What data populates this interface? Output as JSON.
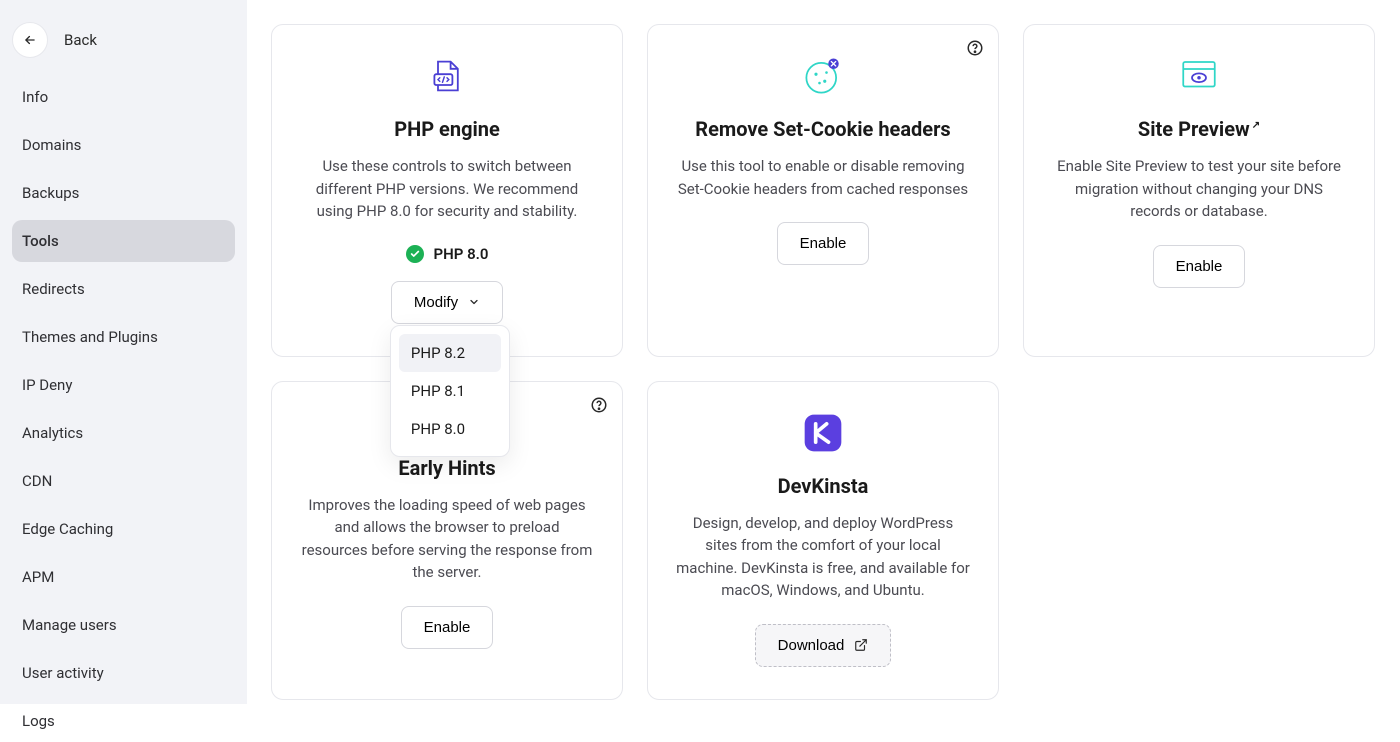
{
  "back_label": "Back",
  "sidebar": {
    "items": [
      {
        "label": "Info"
      },
      {
        "label": "Domains"
      },
      {
        "label": "Backups"
      },
      {
        "label": "Tools",
        "active": true
      },
      {
        "label": "Redirects"
      },
      {
        "label": "Themes and Plugins"
      },
      {
        "label": "IP Deny"
      },
      {
        "label": "Analytics"
      },
      {
        "label": "CDN"
      },
      {
        "label": "Edge Caching"
      },
      {
        "label": "APM"
      },
      {
        "label": "Manage users"
      },
      {
        "label": "User activity"
      },
      {
        "label": "Logs"
      }
    ]
  },
  "cards": {
    "php_engine": {
      "title": "PHP engine",
      "desc": "Use these controls to switch between different PHP versions. We recommend using PHP 8.0 for security and stability.",
      "current": "PHP 8.0",
      "modify_label": "Modify",
      "options": [
        "PHP 8.2",
        "PHP 8.1",
        "PHP 8.0"
      ]
    },
    "remove_cookie": {
      "title": "Remove Set-Cookie headers",
      "desc": "Use this tool to enable or disable removing Set-Cookie headers from cached responses",
      "button": "Enable"
    },
    "site_preview": {
      "title": "Site Preview",
      "desc": "Enable Site Preview to test your site before migration without changing your DNS records or database.",
      "button": "Enable"
    },
    "early_hints": {
      "title": "Early Hints",
      "desc": "Improves the loading speed of web pages and allows the browser to preload resources before serving the response from the server.",
      "button": "Enable"
    },
    "devkinsta": {
      "title": "DevKinsta",
      "desc": "Design, develop, and deploy WordPress sites from the comfort of your local machine. DevKinsta is free, and available for macOS, Windows, and Ubuntu.",
      "button": "Download"
    }
  }
}
